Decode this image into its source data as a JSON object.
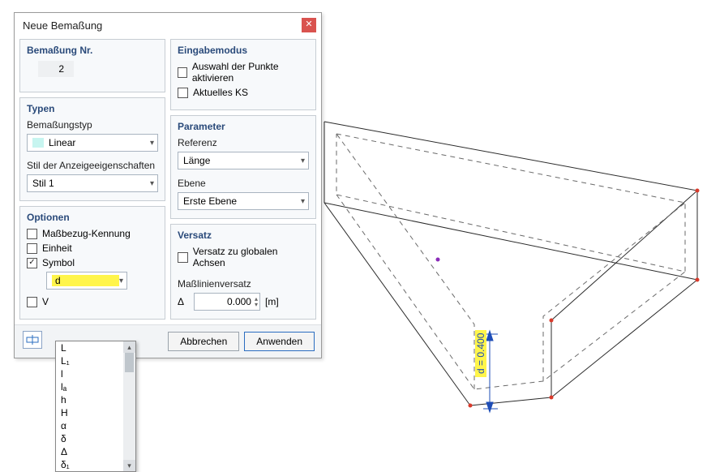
{
  "dialog": {
    "title": "Neue Bemaßung",
    "bemassung_nr": {
      "title": "Bemaßung Nr.",
      "value": "2"
    },
    "eingabemodus": {
      "title": "Eingabemodus",
      "opt_points": "Auswahl der Punkte aktivieren",
      "opt_ks": "Aktuelles KS"
    },
    "typen": {
      "title": "Typen",
      "type_label": "Bemaßungstyp",
      "type_value": "Linear",
      "style_label": "Stil der Anzeigeeigenschaften",
      "style_value": "Stil 1"
    },
    "parameter": {
      "title": "Parameter",
      "ref_label": "Referenz",
      "ref_value": "Länge",
      "plane_label": "Ebene",
      "plane_value": "Erste Ebene"
    },
    "optionen": {
      "title": "Optionen",
      "opt_ref": "Maßbezug-Kennung",
      "opt_unit": "Einheit",
      "opt_symbol": "Symbol",
      "symbol_value": "d",
      "opt_v": "V"
    },
    "versatz": {
      "title": "Versatz",
      "global_axes": "Versatz zu globalen Achsen",
      "offset_label": "Maßlinienversatz",
      "delta": "Δ",
      "value": "0.000",
      "unit": "[m]"
    },
    "buttons": {
      "cancel": "Abbrechen",
      "apply": "Anwenden"
    }
  },
  "dropdown_items": [
    "L",
    "L₁",
    "l",
    "lₐ",
    "h",
    "H",
    "α",
    "δ",
    "Δ",
    "δ₁"
  ],
  "viewport": {
    "dim_text": "d = 0.400"
  },
  "chart_data": {
    "type": "table",
    "title": "Symbol dropdown options",
    "categories": [
      "Symbol"
    ],
    "values": [
      "d",
      "L",
      "L₁",
      "l",
      "lₐ",
      "h",
      "H",
      "α",
      "δ",
      "Δ",
      "δ₁"
    ]
  }
}
